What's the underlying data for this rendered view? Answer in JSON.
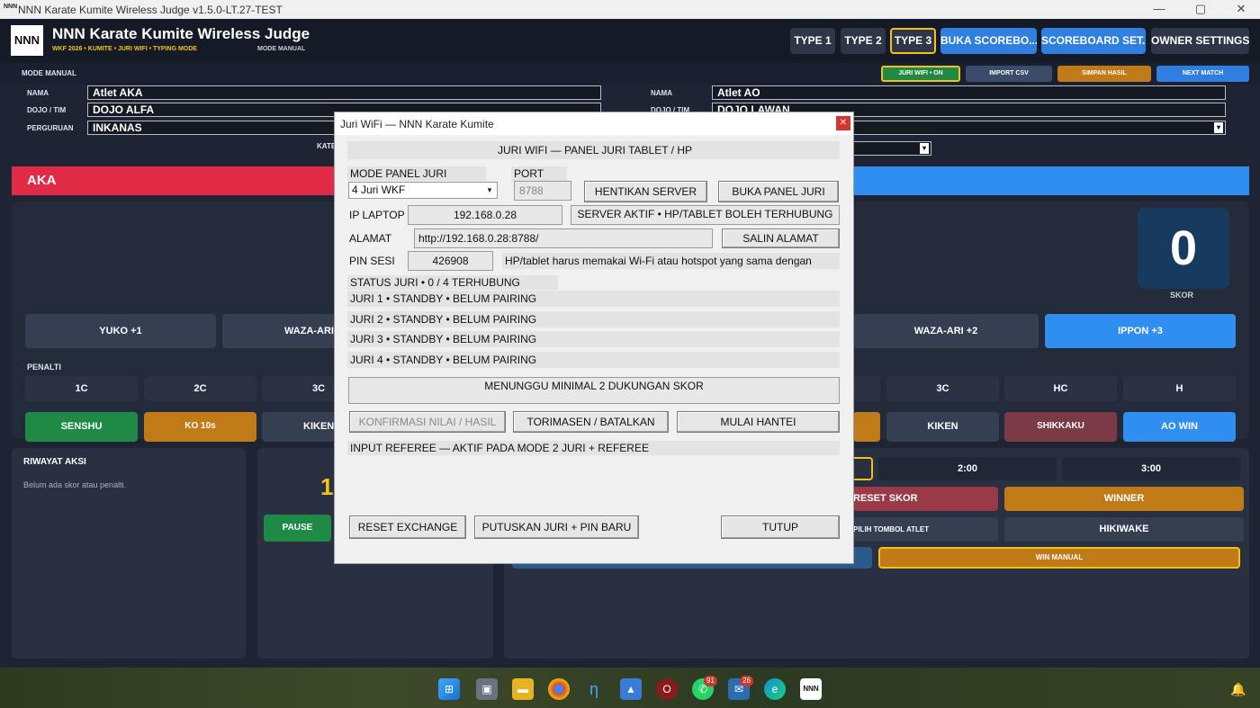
{
  "window": {
    "title": "NNN Karate Kumite Wireless Judge v1.5.0-LT.27-TEST",
    "icon": "NNN",
    "min": "—",
    "max": "▢",
    "close": "✕"
  },
  "header": {
    "logo": "NNN",
    "title": "NNN Karate Kumite Wireless Judge",
    "subtitle": "WKF 2026 • KUMITE • JURI WIFI • TYPING MODE",
    "mode": "MODE MANUAL",
    "buttons": [
      "TYPE 1",
      "TYPE 2",
      "TYPE 3",
      "BUKA SCOREBO...",
      "SCOREBOARD SET...",
      "OWNER SETTINGS"
    ]
  },
  "strip": {
    "mode_label": "MODE MANUAL",
    "buttons": [
      "JURI WIFI • ON",
      "IMPORT CSV",
      "SIMPAN HASIL",
      "NEXT MATCH"
    ]
  },
  "form": {
    "left": {
      "nama_label": "NAMA",
      "nama": "Atlet AKA",
      "dojo_label": "DOJO / TIM",
      "dojo": "DOJO ALFA",
      "perguruan_label": "PERGURUAN",
      "perguruan": "INKANAS"
    },
    "right": {
      "nama_label": "NAMA",
      "nama": "Atlet AO",
      "dojo_label": "DOJO / TIM",
      "dojo": "DOJO LAWAN"
    },
    "kategori_label": "KATE"
  },
  "aka": {
    "label": "AKA"
  },
  "ao": {
    "score": "0",
    "score_label": "SKOR"
  },
  "score_buttons": {
    "yuko": "YUKO  +1",
    "waza_ari_left": "WAZA-ARI",
    "waza_ari_right": "WAZA-ARI  +2",
    "ippon": "IPPON  +3"
  },
  "penalti": {
    "label": "PENALTI",
    "left": [
      "1C",
      "2C",
      "3C"
    ],
    "right": [
      "3C",
      "HC",
      "H"
    ]
  },
  "actions": {
    "senshu": "SENSHU",
    "ko": "KO 10s",
    "kiken_left": "KIKEN",
    "kiken_right": "KIKEN",
    "shikkaku": "SHIKKAKU",
    "ao_win": "AO WIN"
  },
  "riwayat": {
    "title": "RIWAYAT AKSI",
    "empty": "Belum ada skor atau penalti."
  },
  "timer": {
    "digit": "1",
    "pause": "PAUSE",
    "t2": "2:00",
    "t3": "3:00"
  },
  "control": {
    "reset_skor": "RESET SKOR",
    "winner": "WINNER",
    "pilih_tombol": "PILIH TOMBOL ATLET",
    "hikiwake": "HIKIWAKE",
    "win_manual": "WIN MANUAL"
  },
  "dialog": {
    "title": "Juri WiFi — NNN Karate Kumite",
    "heading": "JURI WIFI — PANEL JURI TABLET / HP",
    "mode_label": "MODE PANEL JURI",
    "mode_value": "4 Juri WKF",
    "port_label": "PORT",
    "port_value": "8788",
    "btn_stop": "HENTIKAN SERVER",
    "btn_open": "BUKA PANEL JURI",
    "ip_label": "IP LAPTOP",
    "ip_value": "192.168.0.28",
    "server_status": "SERVER AKTIF • HP/TABLET BOLEH TERHUBUNG",
    "alamat_label": "ALAMAT",
    "alamat_value": "http://192.168.0.28:8788/",
    "btn_copy": "SALIN ALAMAT",
    "pin_label": "PIN SESI",
    "pin_value": "426908",
    "pin_note": "HP/tablet harus memakai Wi-Fi atau hotspot yang sama dengan",
    "status": "STATUS JURI • 0 / 4 TERHUBUNG",
    "judges": [
      "JURI 1 • STANDBY • BELUM PAIRING",
      "JURI 2 • STANDBY • BELUM PAIRING",
      "JURI 3 • STANDBY • BELUM PAIRING",
      "JURI 4 • STANDBY • BELUM PAIRING"
    ],
    "waiting": "MENUNGGU MINIMAL 2 DUKUNGAN SKOR",
    "btn_confirm": "KONFIRMASI NILAI / HASIL",
    "btn_torimasen": "TORIMASEN / BATALKAN",
    "btn_hantei": "MULAI HANTEI",
    "referee": "INPUT REFEREE — AKTIF PADA MODE 2 JURI + REFEREE",
    "btn_reset": "RESET EXCHANGE",
    "btn_disconnect": "PUTUSKAN JURI + PIN BARU",
    "btn_close": "TUTUP"
  },
  "taskbar": {
    "badges": [
      "91",
      "26"
    ],
    "nnn": "NNN"
  }
}
